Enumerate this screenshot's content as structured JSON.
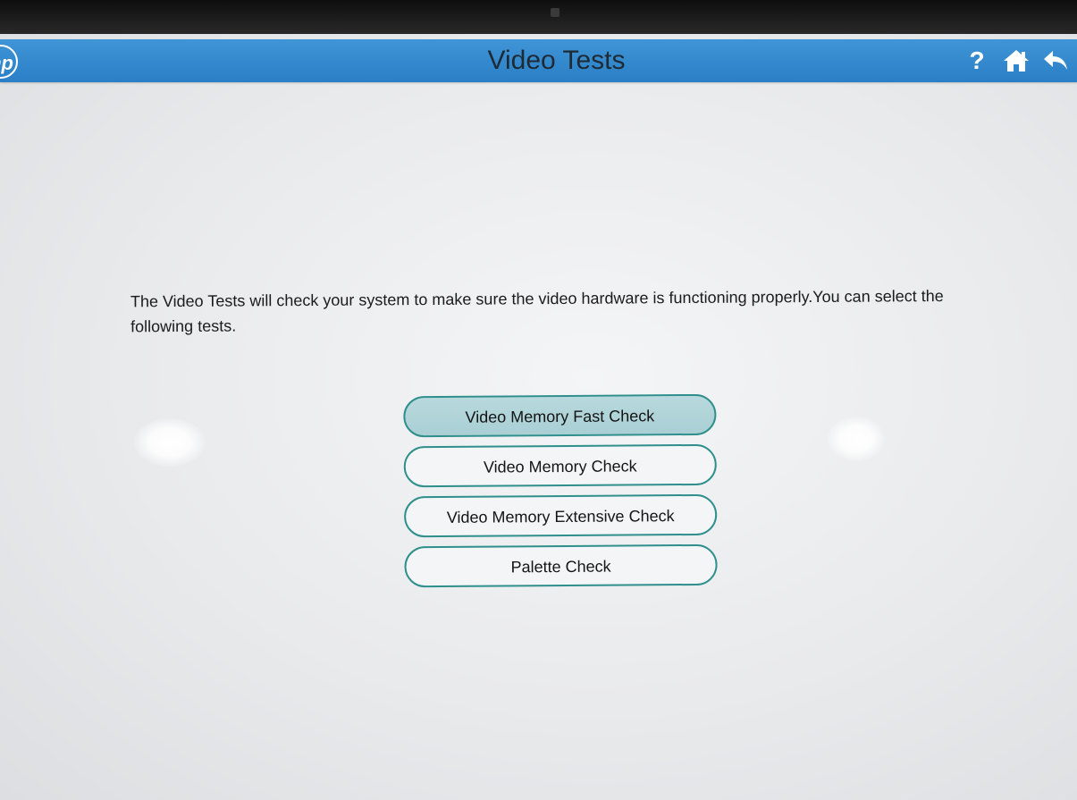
{
  "header": {
    "logo_text": "hp",
    "title": "Video Tests",
    "icons": {
      "help": "help-icon",
      "home": "home-icon",
      "back": "back-arrow-icon"
    },
    "help_glyph": "?",
    "color": "#2a7fc6"
  },
  "main": {
    "description": "The Video Tests will check your system to make sure the video hardware is functioning properly.You can select the following tests.",
    "tests": [
      {
        "label": "Video Memory Fast Check",
        "selected": true
      },
      {
        "label": "Video Memory Check",
        "selected": false
      },
      {
        "label": "Video Memory Extensive Check",
        "selected": false
      },
      {
        "label": "Palette Check",
        "selected": false
      }
    ]
  },
  "colors": {
    "accent": "#2f8f8c",
    "selected_fill": "#b8d9dd"
  }
}
